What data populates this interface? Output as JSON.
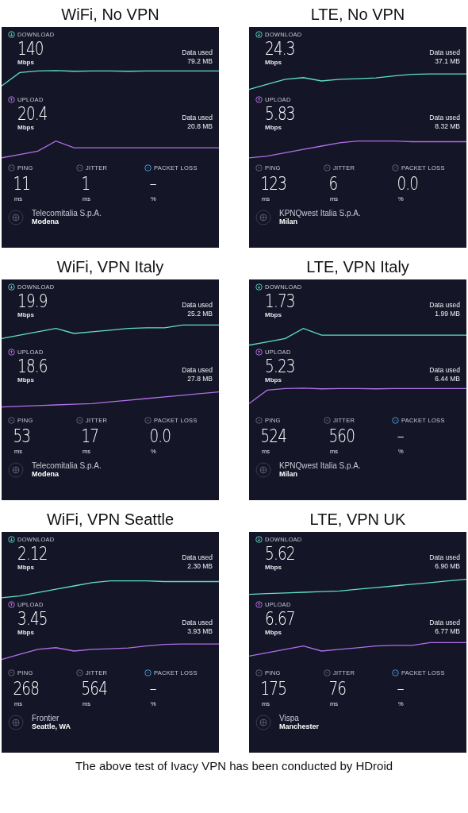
{
  "panels": [
    {
      "title": "WiFi, No VPN",
      "download": {
        "label": "DOWNLOAD",
        "value": "140",
        "unit": "Mbps",
        "data_label": "Data used",
        "data_value": "79.2 MB"
      },
      "upload": {
        "label": "UPLOAD",
        "value": "20.4",
        "unit": "Mbps",
        "data_label": "Data used",
        "data_value": "20.8 MB"
      },
      "stats": [
        {
          "label": "PING",
          "value": "11",
          "unit": "ms"
        },
        {
          "label": "JITTER",
          "value": "1",
          "unit": "ms"
        },
        {
          "label": "PACKET LOSS",
          "value": "–",
          "unit": "%"
        }
      ],
      "server": {
        "name": "Telecomitalia S.p.A.",
        "city": "Modena"
      }
    },
    {
      "title": "LTE, No VPN",
      "download": {
        "label": "DOWNLOAD",
        "value": "24.3",
        "unit": "Mbps",
        "data_label": "Data used",
        "data_value": "37.1 MB"
      },
      "upload": {
        "label": "UPLOAD",
        "value": "5.83",
        "unit": "Mbps",
        "data_label": "Data used",
        "data_value": "8.32 MB"
      },
      "stats": [
        {
          "label": "PING",
          "value": "123",
          "unit": "ms"
        },
        {
          "label": "JITTER",
          "value": "6",
          "unit": "ms"
        },
        {
          "label": "PACKET LOSS",
          "value": "0.0",
          "unit": "%"
        }
      ],
      "server": {
        "name": "KPNQwest Italia S.p.A.",
        "city": "Milan"
      }
    },
    {
      "title": "WiFi, VPN Italy",
      "download": {
        "label": "DOWNLOAD",
        "value": "19.9",
        "unit": "Mbps",
        "data_label": "Data used",
        "data_value": "25.2 MB"
      },
      "upload": {
        "label": "UPLOAD",
        "value": "18.6",
        "unit": "Mbps",
        "data_label": "Data used",
        "data_value": "27.8 MB"
      },
      "stats": [
        {
          "label": "PING",
          "value": "53",
          "unit": "ms"
        },
        {
          "label": "JITTER",
          "value": "17",
          "unit": "ms"
        },
        {
          "label": "PACKET LOSS",
          "value": "0.0",
          "unit": "%"
        }
      ],
      "server": {
        "name": "Telecomitalia S.p.A.",
        "city": "Modena"
      }
    },
    {
      "title": "LTE, VPN Italy",
      "download": {
        "label": "DOWNLOAD",
        "value": "1.73",
        "unit": "Mbps",
        "data_label": "Data used",
        "data_value": "1.99 MB"
      },
      "upload": {
        "label": "UPLOAD",
        "value": "5.23",
        "unit": "Mbps",
        "data_label": "Data used",
        "data_value": "6.44 MB"
      },
      "stats": [
        {
          "label": "PING",
          "value": "524",
          "unit": "ms"
        },
        {
          "label": "JITTER",
          "value": "560",
          "unit": "ms"
        },
        {
          "label": "PACKET LOSS",
          "value": "–",
          "unit": "%"
        }
      ],
      "server": {
        "name": "KPNQwest Italia S.p.A.",
        "city": "Milan"
      }
    },
    {
      "title": "WiFi, VPN Seattle",
      "download": {
        "label": "DOWNLOAD",
        "value": "2.12",
        "unit": "Mbps",
        "data_label": "Data used",
        "data_value": "2.30 MB"
      },
      "upload": {
        "label": "UPLOAD",
        "value": "3.45",
        "unit": "Mbps",
        "data_label": "Data used",
        "data_value": "3.93 MB"
      },
      "stats": [
        {
          "label": "PING",
          "value": "268",
          "unit": "ms"
        },
        {
          "label": "JITTER",
          "value": "564",
          "unit": "ms"
        },
        {
          "label": "PACKET LOSS",
          "value": "–",
          "unit": "%"
        }
      ],
      "server": {
        "name": "Frontier",
        "city": "Seattle, WA"
      }
    },
    {
      "title": "LTE, VPN UK",
      "download": {
        "label": "DOWNLOAD",
        "value": "5.62",
        "unit": "Mbps",
        "data_label": "Data used",
        "data_value": "6.90 MB"
      },
      "upload": {
        "label": "UPLOAD",
        "value": "6.67",
        "unit": "Mbps",
        "data_label": "Data used",
        "data_value": "6.77 MB"
      },
      "stats": [
        {
          "label": "PING",
          "value": "175",
          "unit": "ms"
        },
        {
          "label": "JITTER",
          "value": "76",
          "unit": "ms"
        },
        {
          "label": "PACKET LOSS",
          "value": "–",
          "unit": "%"
        }
      ],
      "server": {
        "name": "Vispa",
        "city": "Manchester"
      }
    }
  ],
  "caption": "The above test of Ivacy VPN has been conducted by HDroid"
}
